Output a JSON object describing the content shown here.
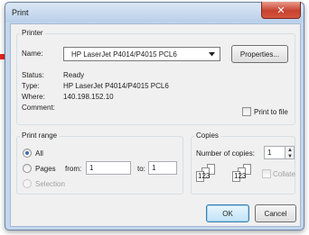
{
  "window": {
    "title": "Print",
    "close_glyph": "✕"
  },
  "printer": {
    "group_label": "Printer",
    "name_label": "Name:",
    "name_value": "HP LaserJet P4014/P4015 PCL6",
    "properties_button": "Properties...",
    "status_label": "Status:",
    "status_value": "Ready",
    "type_label": "Type:",
    "type_value": "HP LaserJet P4014/P4015 PCL6",
    "where_label": "Where:",
    "where_value": "140.198.152.10",
    "comment_label": "Comment:",
    "print_to_file_label": "Print to file"
  },
  "print_range": {
    "group_label": "Print range",
    "all_label": "All",
    "pages_label": "Pages",
    "from_label": "from:",
    "from_value": "1",
    "to_label": "to:",
    "to_value": "1",
    "selection_label": "Selection"
  },
  "copies": {
    "group_label": "Copies",
    "number_label": "Number of copies:",
    "number_value": "1",
    "collate_label": "Collate",
    "collate_glyph_set": "123"
  },
  "footer": {
    "ok_button": "OK",
    "cancel_button": "Cancel"
  },
  "annotation": {
    "arrow_color": "#e8231f"
  },
  "icons": {
    "close": "close-icon",
    "dropdown": "chevron-down-icon",
    "spin_up": "spin-up-icon",
    "spin_down": "spin-down-icon",
    "arrow": "red-arrow-icon",
    "collate": "collate-pages-icon"
  }
}
